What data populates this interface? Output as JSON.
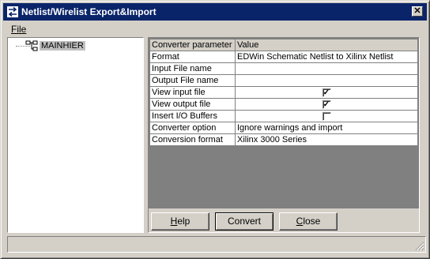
{
  "window": {
    "title": "Netlist/Wirelist Export&Import",
    "close_glyph": "✕"
  },
  "menu": {
    "file_label": "File"
  },
  "tree": {
    "root_label": "MAINHIER"
  },
  "grid": {
    "columns": [
      "Converter parameter",
      "Value"
    ],
    "rows": [
      {
        "param": "Format",
        "value": "EDWin Schematic Netlist to Xilinx Netlist"
      },
      {
        "param": "Input File name",
        "value": ""
      },
      {
        "param": "Output File name",
        "value": ""
      },
      {
        "param": "View input file",
        "checked": true
      },
      {
        "param": "View output file",
        "checked": true
      },
      {
        "param": "Insert I/O Buffers",
        "checked": false
      },
      {
        "param": "Converter option",
        "value": "Ignore warnings and import"
      },
      {
        "param": "Conversion format",
        "value": "Xilinx 3000 Series"
      }
    ],
    "check_glyph": "✓"
  },
  "buttons": {
    "help_label": "Help",
    "convert_label": "Convert",
    "close_label": "Close"
  },
  "colors": {
    "title_bar": "#0a246a",
    "face": "#d4d0c8",
    "selection": "#c0c0c0"
  }
}
